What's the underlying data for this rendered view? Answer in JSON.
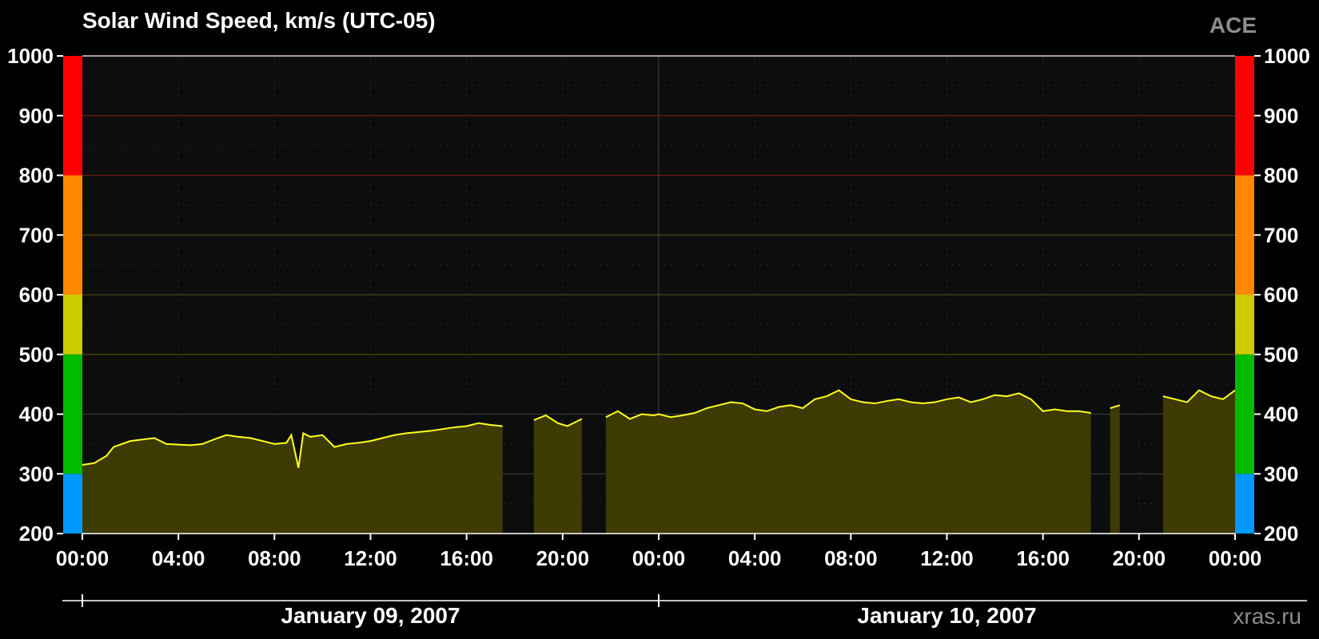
{
  "title": "Solar Wind Speed, km/s (UTC-05)",
  "source_label": "ACE",
  "credit": "xras.ru",
  "colors": {
    "background": "#000000",
    "plot_background": "#0d0d0d",
    "line": "#ffff22",
    "fill": "#3d3a02",
    "grid": "#3a3a3a",
    "band_blue": "#0099ff",
    "band_green": "#00bb00",
    "band_yellow": "#cccc00",
    "band_orange": "#ff8800",
    "band_red": "#ff0000"
  },
  "chart_data": {
    "type": "area",
    "title": "Solar Wind Speed, km/s (UTC-05)",
    "x_unit": "hours since January 09, 2007 00:00 (UTC-05)",
    "xlim": [
      0,
      48
    ],
    "ylim": [
      200,
      1000
    ],
    "y_ticks": [
      200,
      300,
      400,
      500,
      600,
      700,
      800,
      900,
      1000
    ],
    "y_tick_labels": [
      "200",
      "300",
      "400",
      "500",
      "600",
      "700",
      "800",
      "900",
      "1000"
    ],
    "x_ticks": [
      0,
      4,
      8,
      12,
      16,
      20,
      24,
      28,
      32,
      36,
      40,
      44,
      48
    ],
    "x_tick_labels": [
      "00:00",
      "04:00",
      "08:00",
      "12:00",
      "16:00",
      "20:00",
      "00:00",
      "04:00",
      "08:00",
      "12:00",
      "16:00",
      "20:00",
      "00:00"
    ],
    "date_labels": [
      {
        "label": "January 09, 2007",
        "center_hour": 12
      },
      {
        "label": "January 10, 2007",
        "center_hour": 36
      }
    ],
    "threshold_bands": [
      {
        "from": 200,
        "to": 300,
        "color": "#0099ff"
      },
      {
        "from": 300,
        "to": 500,
        "color": "#00bb00"
      },
      {
        "from": 500,
        "to": 600,
        "color": "#cccc00"
      },
      {
        "from": 600,
        "to": 800,
        "color": "#ff8800"
      },
      {
        "from": 800,
        "to": 1000,
        "color": "#ff0000"
      }
    ],
    "series": [
      {
        "segments": [
          {
            "x": [
              0.0,
              0.5,
              1.0,
              1.3,
              2.0,
              3.0,
              3.5,
              4.5,
              5.0,
              5.5,
              6.0,
              6.5,
              7.0,
              7.5,
              8.0,
              8.5,
              8.7,
              9.0,
              9.2,
              9.5,
              10.0,
              10.5,
              11.0,
              11.5,
              12.0,
              12.5,
              13.0,
              13.5,
              14.0,
              14.5,
              15.0,
              15.5,
              16.0,
              16.5,
              17.0,
              17.5
            ],
            "y": [
              315,
              318,
              330,
              345,
              355,
              360,
              350,
              348,
              350,
              358,
              365,
              362,
              360,
              355,
              350,
              352,
              365,
              310,
              368,
              362,
              365,
              345,
              350,
              352,
              355,
              360,
              365,
              368,
              370,
              372,
              375,
              378,
              380,
              385,
              382,
              380
            ]
          },
          {
            "x": [
              18.8,
              19.3,
              19.8,
              20.2,
              20.8
            ],
            "y": [
              390,
              398,
              385,
              380,
              392
            ]
          },
          {
            "x": [
              21.8,
              22.3,
              22.8,
              23.3,
              23.8,
              24.0,
              24.5,
              25.0,
              25.5,
              26.0,
              26.5,
              27.0,
              27.5,
              28.0,
              28.5,
              29.0,
              29.5,
              30.0,
              30.5,
              31.0,
              31.5,
              32.0,
              32.5,
              33.0,
              33.5,
              34.0,
              34.5,
              35.0,
              35.5,
              36.0,
              36.5,
              37.0,
              37.5,
              38.0,
              38.5,
              39.0,
              39.5,
              40.0,
              40.5,
              41.0,
              41.5,
              42.0
            ],
            "y": [
              395,
              405,
              392,
              400,
              398,
              400,
              395,
              398,
              402,
              410,
              415,
              420,
              418,
              408,
              405,
              412,
              415,
              410,
              425,
              430,
              440,
              425,
              420,
              418,
              422,
              425,
              420,
              418,
              420,
              425,
              428,
              420,
              425,
              432,
              430,
              435,
              425,
              405,
              408,
              405,
              405,
              402
            ]
          },
          {
            "x": [
              42.8,
              43.2
            ],
            "y": [
              410,
              415
            ]
          },
          {
            "x": [
              45.0,
              45.5,
              46.0,
              46.5,
              47.0,
              47.5,
              48.0
            ],
            "y": [
              430,
              425,
              420,
              440,
              430,
              425,
              440
            ]
          }
        ]
      }
    ]
  }
}
